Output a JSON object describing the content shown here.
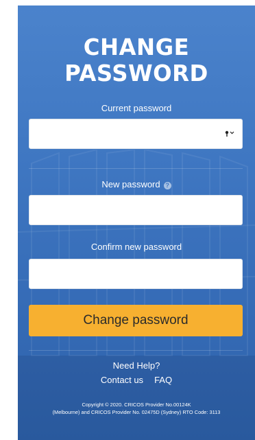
{
  "form": {
    "title_line1": "CHANGE",
    "title_line2": "PASSWORD",
    "current_password_label": "Current password",
    "new_password_label": "New password",
    "confirm_password_label": "Confirm new password",
    "current_password_value": "",
    "new_password_value": "",
    "confirm_password_value": "",
    "key_icon": "key-icon",
    "help_icon": "question-circle-icon",
    "help_glyph": "?",
    "submit_label": "Change password"
  },
  "help": {
    "title": "Need Help?",
    "contact_label": "Contact us",
    "faq_label": "FAQ"
  },
  "footer": {
    "copyright_line1": "Copyright © 2020. CRICOS Provider No.00124K",
    "copyright_line2": "(Melbourne) and CRICOS Provider No. 02475D (Sydney) RTO Code: 3113"
  },
  "colors": {
    "panel": "#3f77c2",
    "button": "#f7b030",
    "text": "#ffffff"
  }
}
